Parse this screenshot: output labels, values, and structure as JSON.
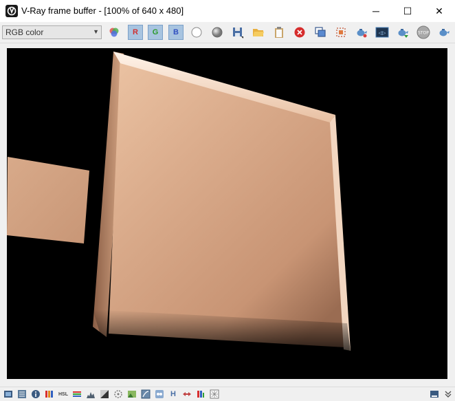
{
  "window": {
    "title": "V-Ray frame buffer - [100% of 640 x 480]",
    "minimize_glyph": "─",
    "maximize_glyph": "☐",
    "close_glyph": "✕"
  },
  "toolbar": {
    "channel_value": "RGB color",
    "red_channel_label": "R",
    "green_channel_label": "G",
    "blue_channel_label": "B",
    "stop_label": "STOP",
    "icons": [
      "color-corrections-icon",
      "red-channel-icon",
      "green-channel-icon",
      "blue-channel-icon",
      "white-circle-icon",
      "grey-circle-icon",
      "save-icon",
      "open-icon",
      "clipboard-icon",
      "clear-icon",
      "duplicate-to-history-icon",
      "region-render-icon",
      "teapot-render-icon",
      "display-correction-icon",
      "teapot-interactive-icon",
      "stop-icon",
      "teapot-render-last-icon"
    ]
  },
  "statusbar": {
    "h_label": "H",
    "hsl_label": "HSL",
    "icons": [
      "frame-icon",
      "history-icon",
      "info-icon",
      "color-levels-icon",
      "hsl-icon",
      "curves-icon",
      "histogram-icon",
      "exposure-icon",
      "lens-effects-icon",
      "background-icon",
      "lut-icon",
      "ocio-icon",
      "h-icon",
      "white-balance-icon",
      "color-balance-icon",
      "follow-mouse-icon",
      "panel-toggle-icon",
      "expand-icon"
    ]
  },
  "colors": {
    "render_background": "#000000",
    "plane_main": "#c8987a",
    "plane_highlight": "#f6d8c2",
    "plane_small": "#d2a283",
    "button_pressed": "#a8c4e0"
  }
}
